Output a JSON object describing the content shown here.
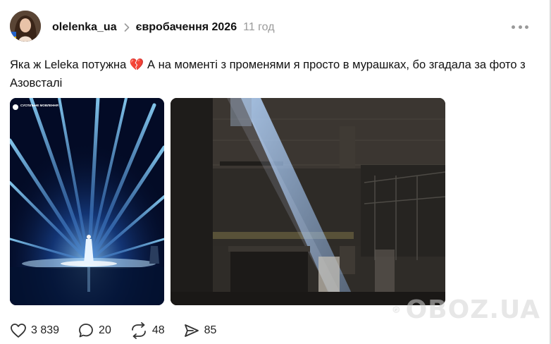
{
  "post": {
    "author": {
      "username": "olelenka_ua"
    },
    "topic": "євробачення 2026",
    "time": "11 год",
    "text": "Яка ж Leleka потужна 💔 А на моменті з променями я просто в мурашках, бо згадала за фото з Азовсталі",
    "media": [
      {
        "kind": "stage-photo",
        "caption_logo": "СУСПІЛЬНЕ МОВЛЕННЯ"
      },
      {
        "kind": "industrial-photo"
      }
    ],
    "actions": {
      "likes": "3 839",
      "comments": "20",
      "reposts": "48",
      "shares": "85"
    }
  },
  "icons": {
    "chevron": "chevron-right-icon",
    "more": "more-horizontal-icon",
    "like": "heart-outline-icon",
    "comment": "speech-bubble-icon",
    "repost": "repost-arrows-icon",
    "share": "send-paper-plane-icon"
  },
  "watermark": {
    "text": "OBOZ.UA"
  }
}
